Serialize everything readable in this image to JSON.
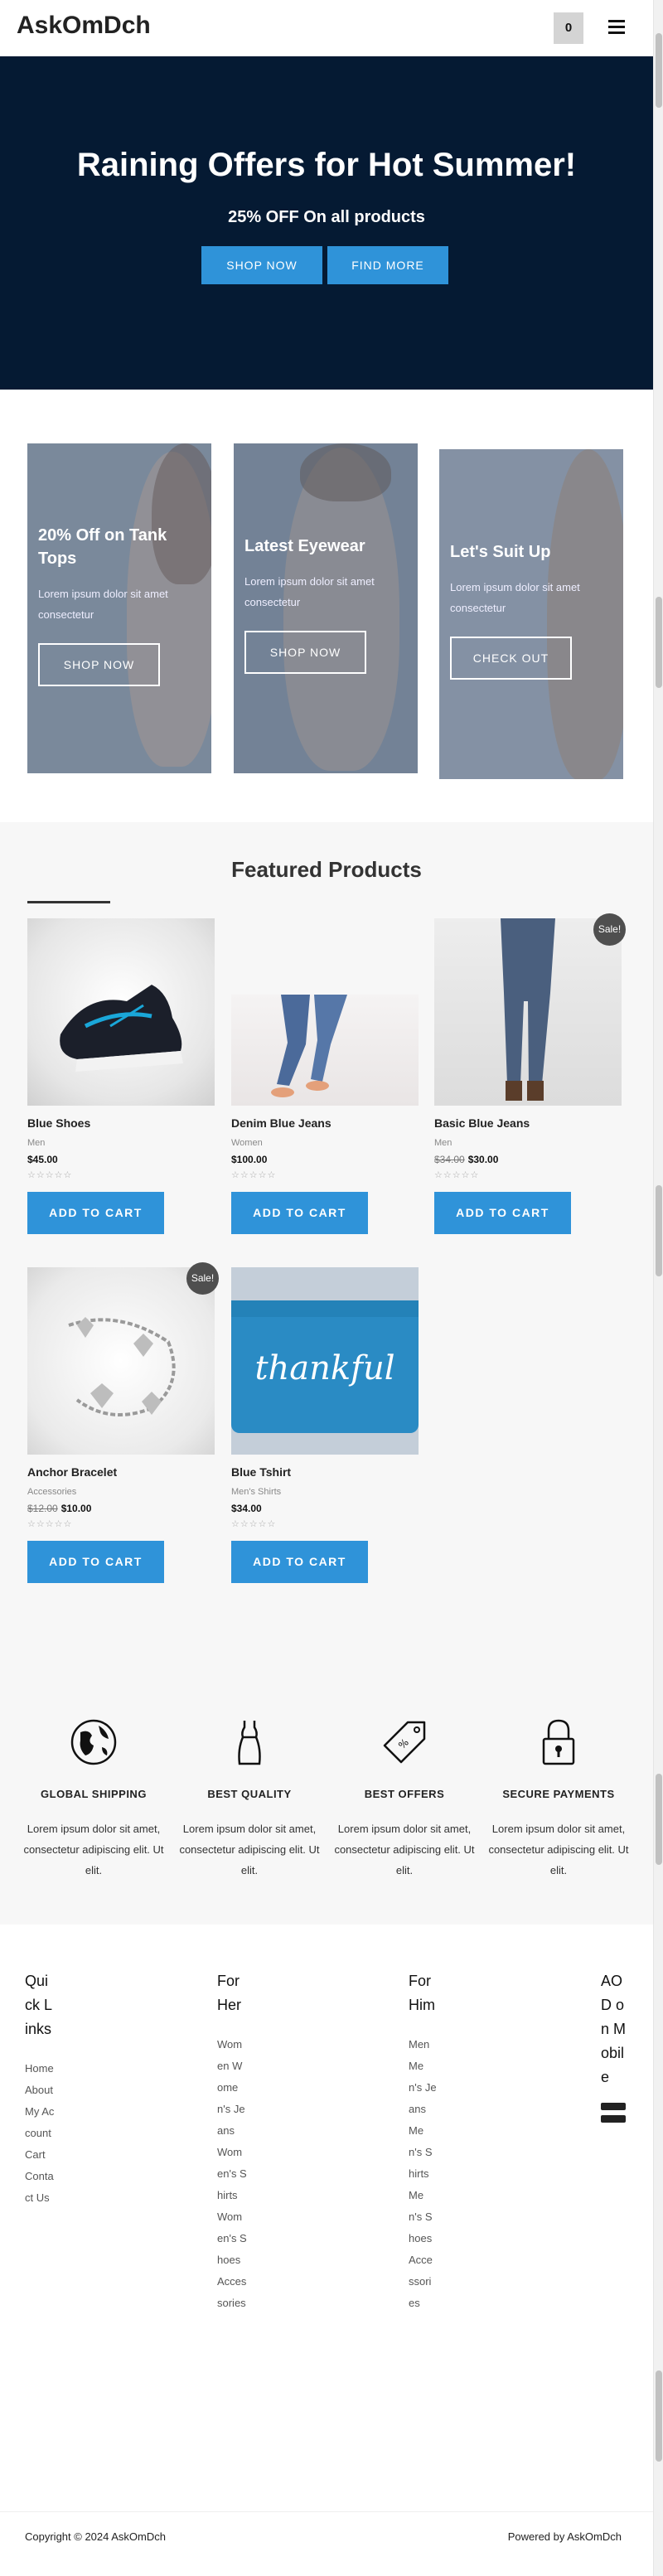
{
  "header": {
    "logo": "AskOmDch",
    "cart_count": "0",
    "menu_icon": "hamburger-menu-icon"
  },
  "hero": {
    "title": "Raining Offers for Hot Summer!",
    "subtitle": "25% OFF On all products",
    "shop_now": "SHOP NOW",
    "find_more": "FIND MORE",
    "bg_color": "#051a33",
    "accent": "#2f93d9"
  },
  "promos": [
    {
      "title": "20% Off on Tank Tops",
      "desc": "Lorem ipsum dolor sit amet consectetur",
      "button": "SHOP NOW"
    },
    {
      "title": "Latest Eyewear",
      "desc": "Lorem ipsum dolor sit amet consectetur",
      "button": "SHOP NOW"
    },
    {
      "title": "Let's Suit Up",
      "desc": "Lorem ipsum dolor sit amet consectetur",
      "button": "CHECK OUT"
    }
  ],
  "featured": {
    "title": "Featured Products",
    "sale_label": "Sale!",
    "add_to_cart": "ADD TO CART",
    "rating_stars": "☆☆☆☆☆",
    "products": [
      {
        "name": "Blue Shoes",
        "category": "Men",
        "price": "$45.00",
        "old_price": ""
      },
      {
        "name": "Denim Blue Jeans",
        "category": "Women",
        "price": "$100.00",
        "old_price": ""
      },
      {
        "name": "Basic Blue Jeans",
        "category": "Men",
        "price": "$30.00",
        "old_price": "$34.00"
      },
      {
        "name": "Anchor Bracelet",
        "category": "Accessories",
        "price": "$10.00",
        "old_price": "$12.00"
      },
      {
        "name": "Blue Tshirt",
        "category": "Men's Shirts",
        "price": "$34.00",
        "old_price": ""
      }
    ],
    "tshirt_text": "thankful"
  },
  "features": [
    {
      "icon": "globe-icon",
      "title": "GLOBAL SHIPPING",
      "desc": "Lorem ipsum dolor sit amet, consectetur adipiscing elit. Ut elit."
    },
    {
      "icon": "dress-icon",
      "title": "BEST QUALITY",
      "desc": "Lorem ipsum dolor sit amet, consectetur adipiscing elit. Ut elit."
    },
    {
      "icon": "price-tag-icon",
      "title": "BEST OFFERS",
      "desc": "Lorem ipsum dolor sit amet, consectetur adipiscing elit. Ut elit."
    },
    {
      "icon": "lock-icon",
      "title": "SECURE PAYMENTS",
      "desc": "Lorem ipsum dolor sit amet, consectetur adipiscing elit. Ut elit."
    }
  ],
  "footer": {
    "quick_links": {
      "title": "Quick Links",
      "items": [
        "Home",
        "About",
        "My Account",
        "Cart",
        "Contact Us"
      ]
    },
    "for_her": {
      "title": "For Her",
      "items": [
        "Women Women's Jeans",
        "Women's Shirts",
        "Women's Shoes",
        "Accessories"
      ]
    },
    "for_him": {
      "title": "For Him",
      "items": [
        "Men Men's Jeans",
        "Men's Shirts",
        "Men's Shoes",
        "Accessories"
      ]
    },
    "app": {
      "title": "AOD on Mobile"
    },
    "copyright": "Copyright © 2024 AskOmDch",
    "powered_by": "Powered by AskOmDch"
  }
}
